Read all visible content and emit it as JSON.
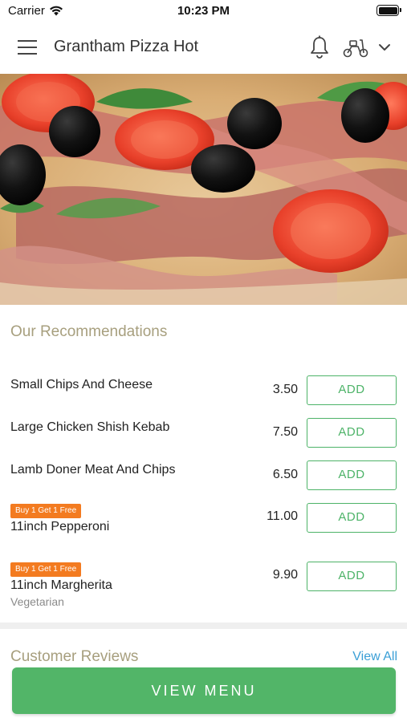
{
  "status_bar": {
    "carrier": "Carrier",
    "time": "10:23 PM"
  },
  "header": {
    "title": "Grantham Pizza Hot",
    "icons": [
      "menu-icon",
      "bell-icon",
      "scooter-icon",
      "chevron-down-icon"
    ]
  },
  "recommendations": {
    "title": "Our Recommendations",
    "items": [
      {
        "name": "Small Chips And Cheese",
        "price": "3.50",
        "button": "ADD",
        "badge": "",
        "note": ""
      },
      {
        "name": "Large Chicken Shish Kebab",
        "price": "7.50",
        "button": "ADD",
        "badge": "",
        "note": ""
      },
      {
        "name": "Lamb Doner Meat And Chips",
        "price": "6.50",
        "button": "ADD",
        "badge": "",
        "note": ""
      },
      {
        "name": "11inch Pepperoni",
        "price": "11.00",
        "button": "ADD",
        "badge": "Buy 1 Get 1 Free",
        "note": ""
      },
      {
        "name": "11inch Margherita",
        "price": "9.90",
        "button": "ADD",
        "badge": "Buy 1 Get 1 Free",
        "note": "Vegetarian"
      }
    ]
  },
  "reviews": {
    "title": "Customer Reviews",
    "view_all": "View All"
  },
  "footer": {
    "view_menu": "VIEW MENU"
  },
  "colors": {
    "accent_green": "#52b568",
    "section_title": "#a79f7e",
    "promo_orange": "#f37b20",
    "link_blue": "#3a9fd6"
  }
}
